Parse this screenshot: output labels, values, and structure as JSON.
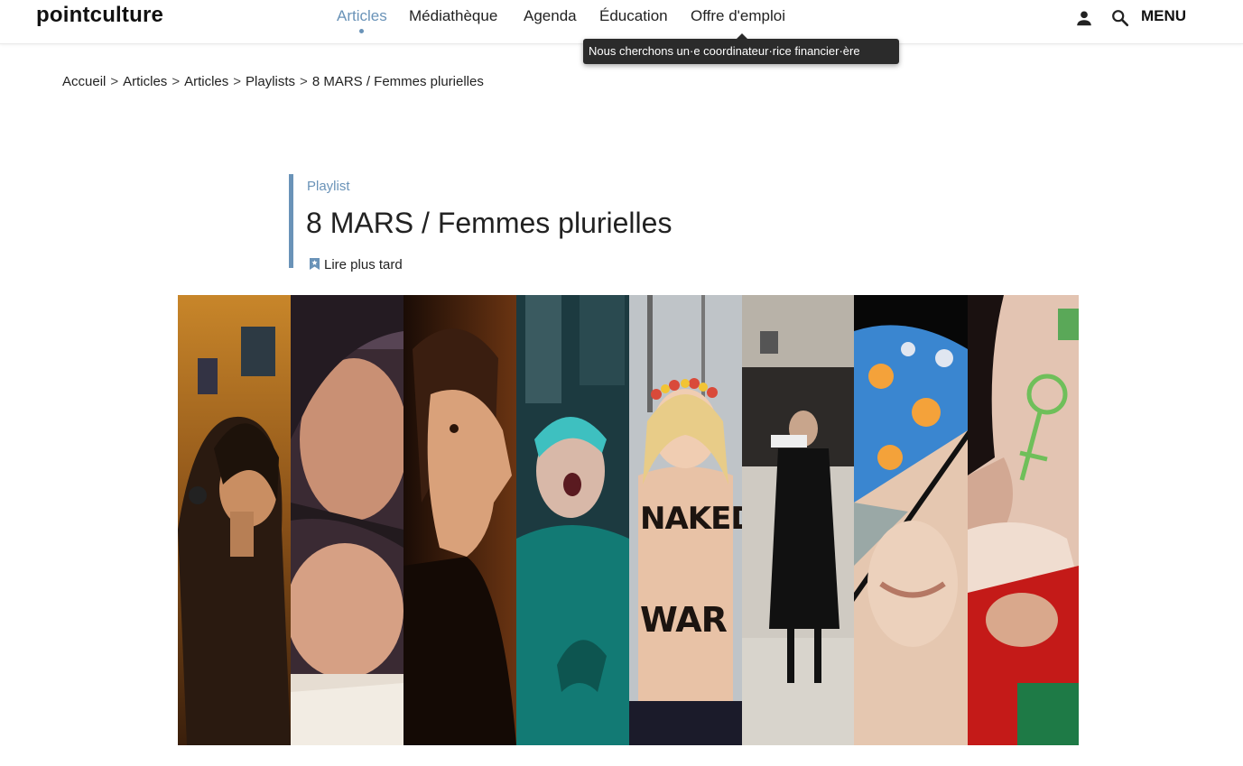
{
  "header": {
    "logo": "pointculture",
    "nav": [
      {
        "label": "Articles",
        "active": true
      },
      {
        "label": "Médiathèque",
        "active": false
      },
      {
        "label": "Agenda",
        "active": false
      },
      {
        "label": "Éducation",
        "active": false
      },
      {
        "label": "Offre d'emploi",
        "active": false
      }
    ],
    "tooltip": "Nous cherchons un·e coordinateur·rice financier·ère",
    "icons": [
      "user-icon",
      "search-icon"
    ],
    "menu_label": "MENU",
    "accent_color": "#6a93b8"
  },
  "breadcrumb": [
    "Accueil",
    "Articles",
    "Articles",
    "Playlists",
    "8 MARS / Femmes plurielles"
  ],
  "article": {
    "kicker": "Playlist",
    "title": "8 MARS / Femmes plurielles",
    "read_later": "Lire plus tard"
  },
  "hero": {
    "panels": [
      {
        "name": "woman-on-phone"
      },
      {
        "name": "sleeping-man-and-woman"
      },
      {
        "name": "woman-crying-profile"
      },
      {
        "name": "protester-shouting"
      },
      {
        "name": "femen-activist",
        "body_text_1": "NAKED",
        "body_text_2": "WAR"
      },
      {
        "name": "woman-in-black-dress"
      },
      {
        "name": "woman-face-floral-scarf"
      },
      {
        "name": "face-with-venus-symbol"
      }
    ]
  }
}
